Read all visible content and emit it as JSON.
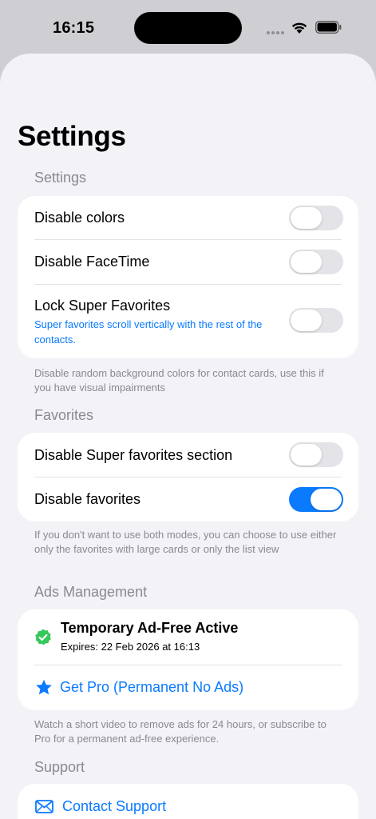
{
  "status": {
    "time": "16:15"
  },
  "page": {
    "title": "Settings"
  },
  "sections": {
    "settings": {
      "header": "Settings",
      "rows": [
        {
          "label": "Disable colors",
          "on": false
        },
        {
          "label": "Disable FaceTime",
          "on": false
        },
        {
          "label": "Lock Super Favorites",
          "subtitle": "Super favorites scroll vertically with the rest of the contacts.",
          "on": false
        }
      ],
      "footer": "Disable random background colors for contact cards, use this if you have visual impairments"
    },
    "favorites": {
      "header": "Favorites",
      "rows": [
        {
          "label": "Disable Super favorites section",
          "on": false
        },
        {
          "label": "Disable favorites",
          "on": true
        }
      ],
      "footer": "If you don't want to use both modes, you can choose to use either only the favorites with large cards or only the list view"
    },
    "ads": {
      "header": "Ads Management",
      "status_title": "Temporary Ad-Free Active",
      "status_subtitle": "Expires: 22 Feb 2026 at 16:13",
      "pro_link": "Get Pro (Permanent No Ads)",
      "footer": "Watch a short video to remove ads for 24 hours, or subscribe to Pro for a permanent ad-free experience."
    },
    "support": {
      "header": "Support",
      "contact_link": "Contact Support"
    }
  },
  "icons": {
    "status_badge": "checkmark-seal-icon",
    "pro": "star-icon",
    "contact": "envelope-icon"
  },
  "colors": {
    "accent": "#0a7aff",
    "success": "#34c759"
  }
}
